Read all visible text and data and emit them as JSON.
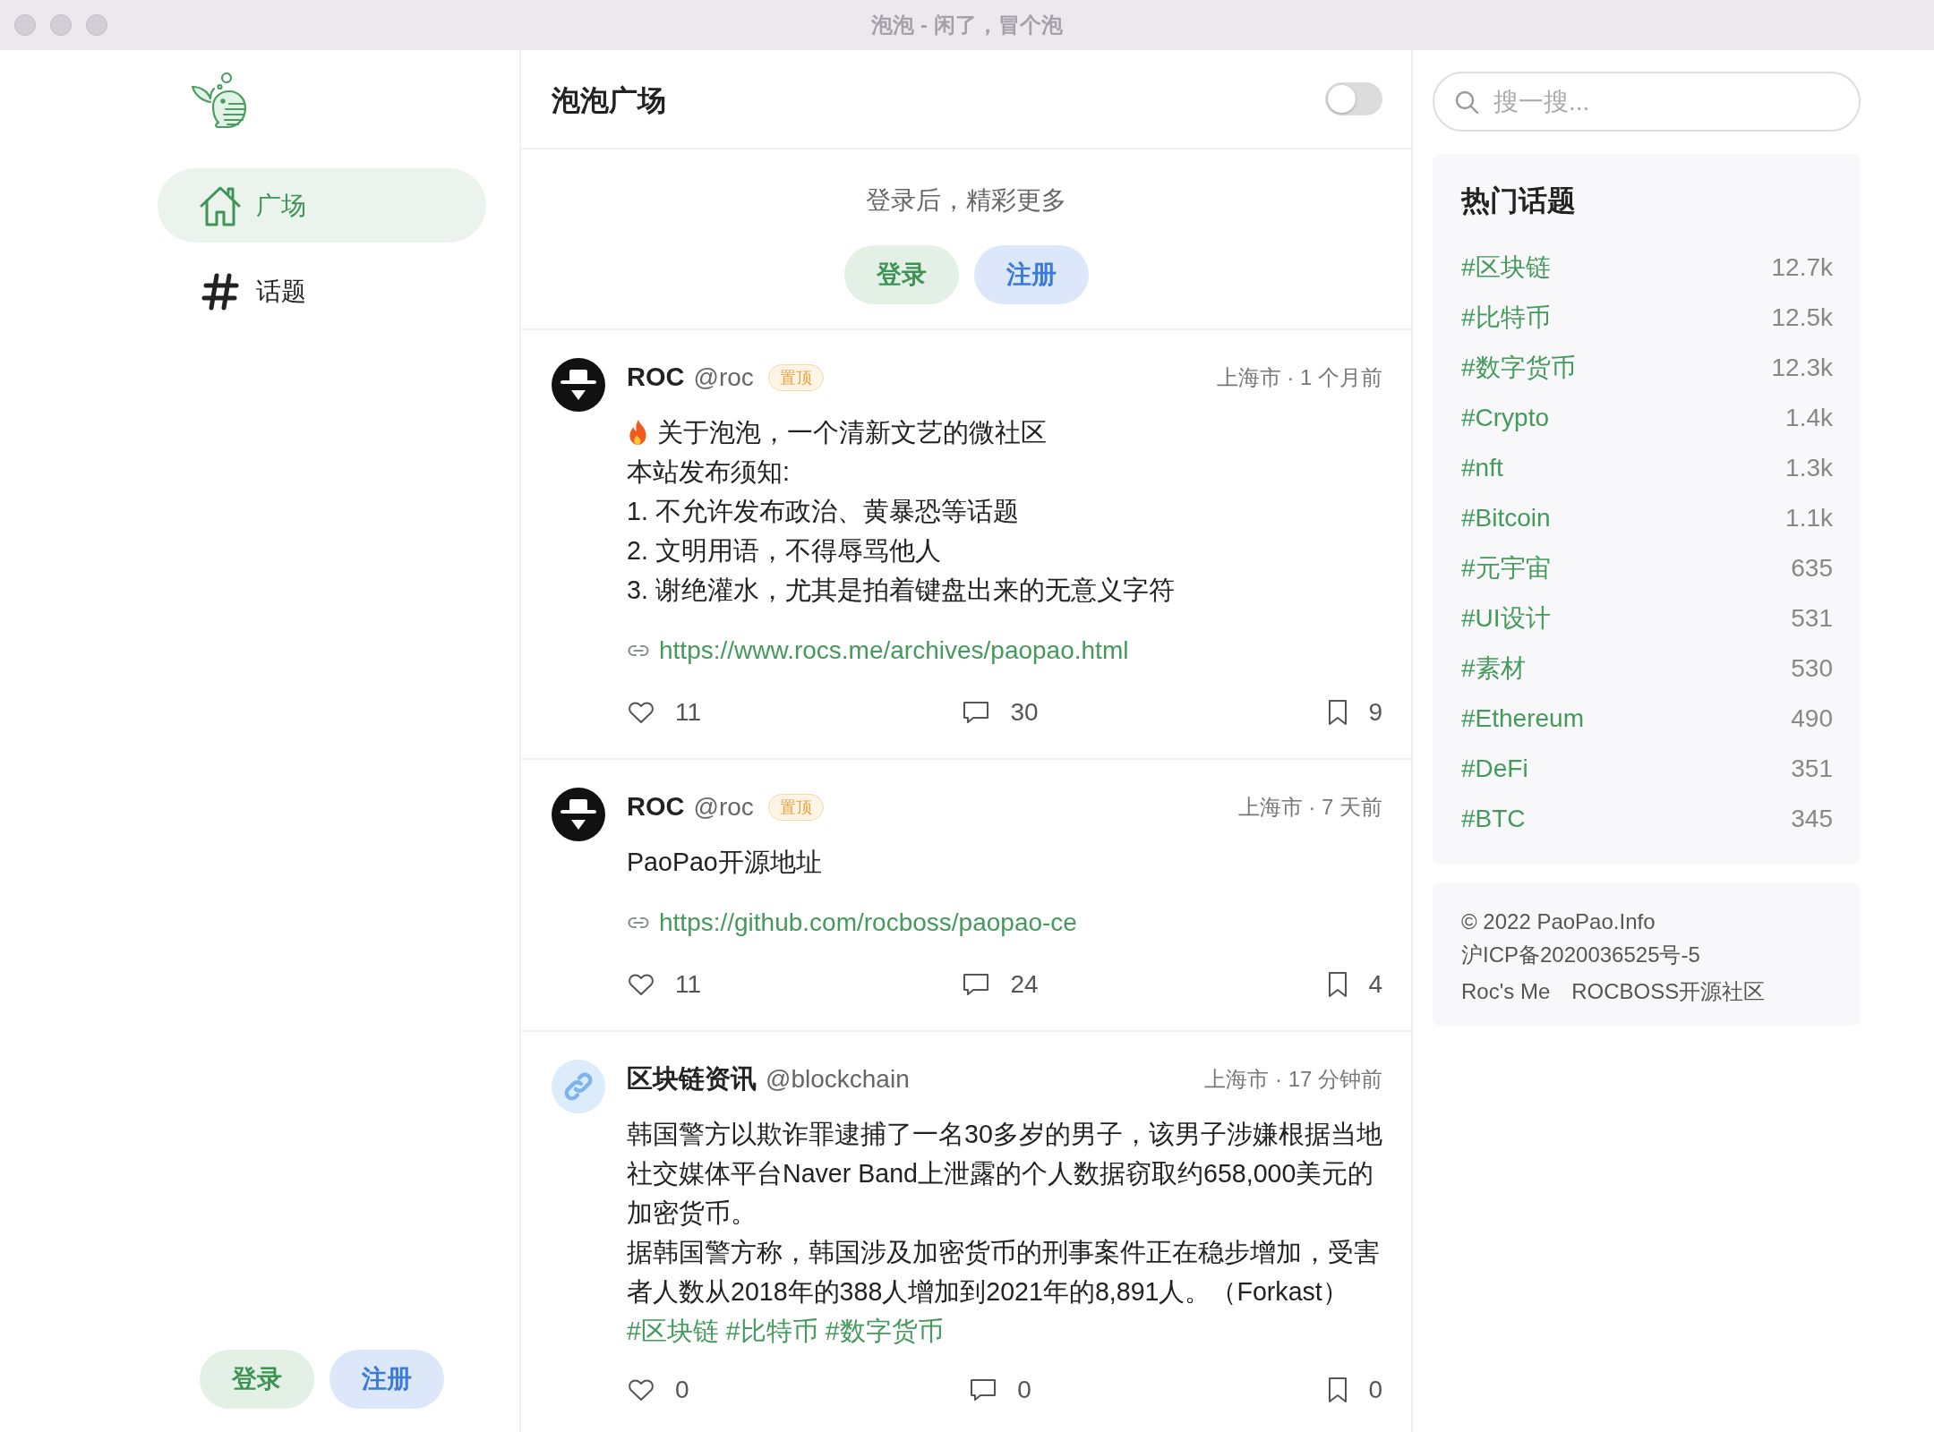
{
  "window": {
    "title": "泡泡 - 闲了，冒个泡"
  },
  "sidebar": {
    "nav": [
      {
        "kind": "home",
        "label": "广场",
        "selected": true
      },
      {
        "kind": "topics",
        "label": "话题",
        "selected": false
      }
    ],
    "buttons": [
      {
        "kind": "login",
        "label": "登录"
      },
      {
        "kind": "register",
        "label": "注册"
      }
    ]
  },
  "feed": {
    "title": "泡泡广场",
    "toggle": {
      "on": false
    },
    "login_prompt": {
      "text": "登录后，精彩更多",
      "buttons": [
        {
          "kind": "login",
          "label": "登录"
        },
        {
          "kind": "register",
          "label": "注册"
        }
      ]
    },
    "posts": [
      {
        "author": {
          "kind": "member",
          "name": "ROC",
          "handle": "@roc"
        },
        "badge": "置顶",
        "meta": "上海市 · 1 个月前",
        "paragraphs": [
          {
            "kind": "lead",
            "text": "关于泡泡，一个清新文艺的微社区"
          },
          {
            "kind": "plain",
            "text": "本站发布须知:"
          },
          {
            "kind": "plain",
            "text": "1. 不允许发布政治、黄暴恐等话题"
          },
          {
            "kind": "plain",
            "text": "2. 文明用语，不得辱骂他人"
          },
          {
            "kind": "plain",
            "text": "3. 谢绝灌水，尤其是拍着键盘出来的无意义字符"
          }
        ],
        "link": "https://www.rocs.me/archives/paopao.html",
        "stats": {
          "likes": "11",
          "comments": "30",
          "bookmarks": "9"
        }
      },
      {
        "author": {
          "kind": "member",
          "name": "ROC",
          "handle": "@roc"
        },
        "badge": "置顶",
        "meta": "上海市 · 7 天前",
        "paragraphs": [
          {
            "kind": "plain",
            "text": "PaoPao开源地址"
          }
        ],
        "link": "https://github.com/rocboss/paopao-ce",
        "stats": {
          "likes": "11",
          "comments": "24",
          "bookmarks": "4"
        }
      },
      {
        "author": {
          "kind": "feed",
          "name": "区块链资讯",
          "handle": "@blockchain"
        },
        "meta": "上海市 · 17 分钟前",
        "paragraphs": [
          {
            "kind": "plain",
            "text": "韩国警方以欺诈罪逮捕了一名30多岁的男子，该男子涉嫌根据当地社交媒体平台Naver Band上泄露的个人数据窃取约658,000美元的加密货币。"
          },
          {
            "kind": "plain",
            "text": "据韩国警方称，韩国涉及加密货币的刑事案件正在稳步增加，受害者人数从2018年的388人增加到2021年的8,891人。（Forkast）"
          }
        ],
        "tags": [
          "#区块链",
          "#比特币",
          "#数字货币"
        ],
        "stats": {
          "likes": "0",
          "comments": "0",
          "bookmarks": "0"
        }
      }
    ]
  },
  "right": {
    "search": {
      "placeholder": "搜一搜..."
    },
    "hot_topics": {
      "title": "热门话题",
      "items": [
        {
          "tag": "#区块链",
          "count": "12.7k"
        },
        {
          "tag": "#比特币",
          "count": "12.5k"
        },
        {
          "tag": "#数字货币",
          "count": "12.3k"
        },
        {
          "tag": "#Crypto",
          "count": "1.4k"
        },
        {
          "tag": "#nft",
          "count": "1.3k"
        },
        {
          "tag": "#Bitcoin",
          "count": "1.1k"
        },
        {
          "tag": "#元宇宙",
          "count": "635"
        },
        {
          "tag": "#UI设计",
          "count": "531"
        },
        {
          "tag": "#素材",
          "count": "530"
        },
        {
          "tag": "#Ethereum",
          "count": "490"
        },
        {
          "tag": "#DeFi",
          "count": "351"
        },
        {
          "tag": "#BTC",
          "count": "345"
        }
      ]
    },
    "footer": {
      "copyright": "© 2022 PaoPao.Info",
      "icp": "沪ICP备2020036525号-5",
      "links": [
        "Roc's Me",
        "ROCBOSS开源社区"
      ]
    }
  }
}
